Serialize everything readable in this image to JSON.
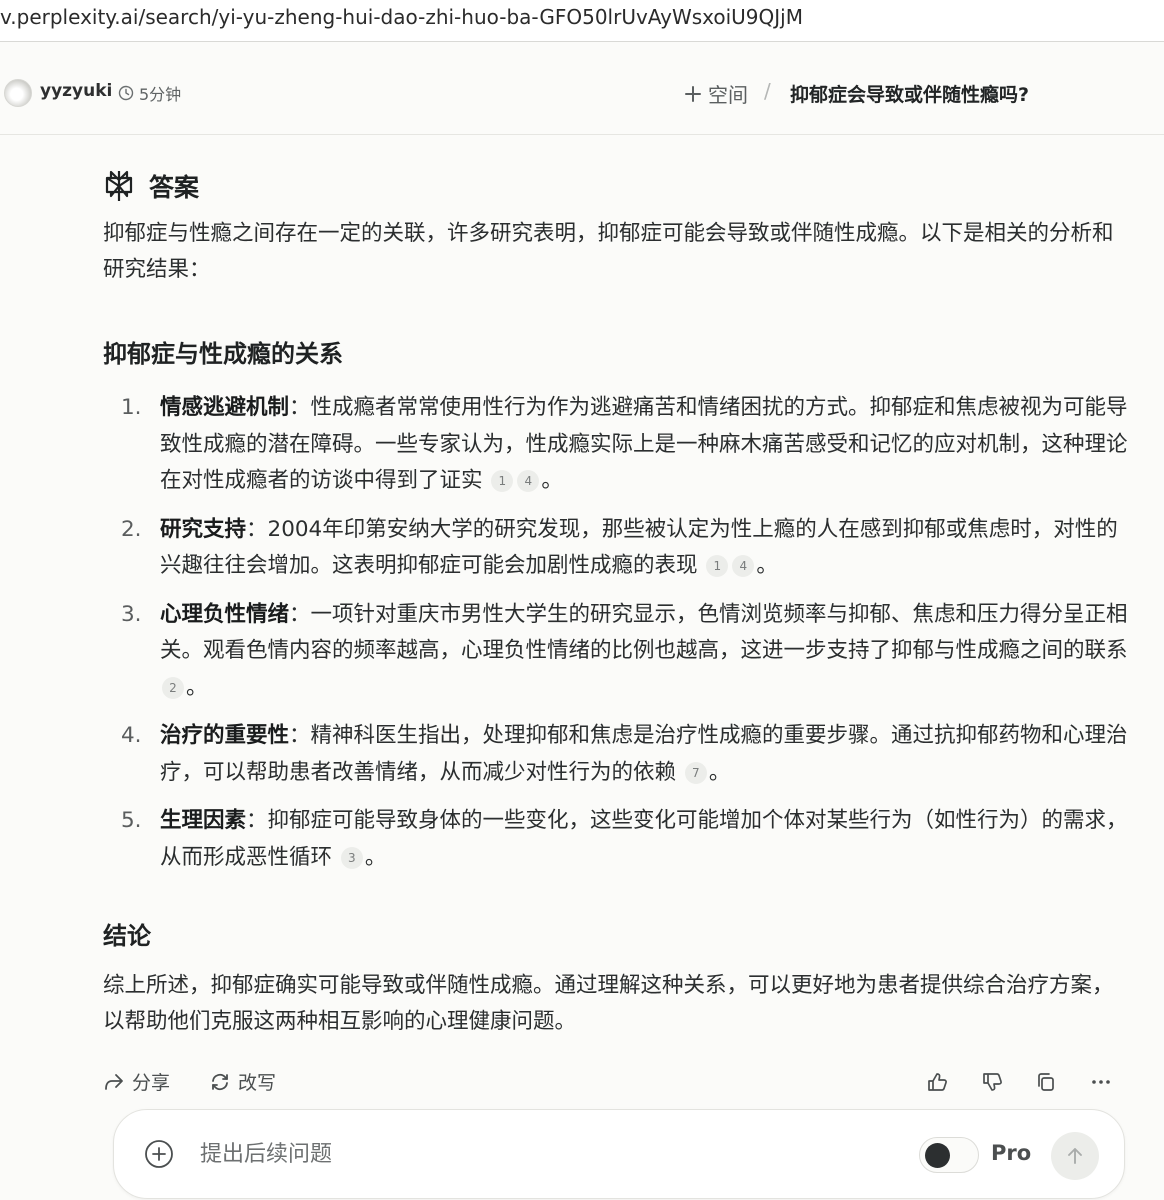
{
  "browser": {
    "url": "v.perplexity.ai/search/yi-yu-zheng-hui-dao-zhi-huo-ba-GFO50lrUvAyWsxoiU9QJjM"
  },
  "header": {
    "username": "yyzyuki",
    "time": "5分钟",
    "space_label": "空间",
    "separator": "/",
    "thread_title": "抑郁症会导致或伴随性瘾吗?"
  },
  "answer": {
    "heading": "答案",
    "intro": "抑郁症与性瘾之间存在一定的关联，许多研究表明，抑郁症可能会导致或伴随性成瘾。以下是相关的分析和研究结果：",
    "section1_title": "抑郁症与性成瘾的关系",
    "items": [
      {
        "num": "1.",
        "title": "情感逃避机制",
        "text": "：性成瘾者常常使用性行为作为逃避痛苦和情绪困扰的方式。抑郁症和焦虑被视为可能导致性成瘾的潜在障碍。一些专家认为，性成瘾实际上是一种麻木痛苦感受和记忆的应对机制，这种理论在对性成瘾者的访谈中得到了证实",
        "cites": [
          "1",
          "4"
        ],
        "end": "。"
      },
      {
        "num": "2.",
        "title": "研究支持",
        "text": "：2004年印第安纳大学的研究发现，那些被认定为性上瘾的人在感到抑郁或焦虑时，对性的兴趣往往会增加。这表明抑郁症可能会加剧性成瘾的表现",
        "cites": [
          "1",
          "4"
        ],
        "end": "。"
      },
      {
        "num": "3.",
        "title": "心理负性情绪",
        "text": "：一项针对重庆市男性大学生的研究显示，色情浏览频率与抑郁、焦虑和压力得分呈正相关。观看色情内容的频率越高，心理负性情绪的比例也越高，这进一步支持了抑郁与性成瘾之间的联系",
        "cites": [
          "2"
        ],
        "end": "。"
      },
      {
        "num": "4.",
        "title": "治疗的重要性",
        "text": "：精神科医生指出，处理抑郁和焦虑是治疗性成瘾的重要步骤。通过抗抑郁药物和心理治疗，可以帮助患者改善情绪，从而减少对性行为的依赖",
        "cites": [
          "7"
        ],
        "end": "。"
      },
      {
        "num": "5.",
        "title": "生理因素",
        "text": "：抑郁症可能导致身体的一些变化，这些变化可能增加个体对某些行为（如性行为）的需求，从而形成恶性循环",
        "cites": [
          "3"
        ],
        "end": "。"
      }
    ],
    "section2_title": "结论",
    "conclusion": "综上所述，抑郁症确实可能导致或伴随性成瘾。通过理解这种关系，可以更好地为患者提供综合治疗方案，以帮助他们克服这两种相互影响的心理健康问题。"
  },
  "actions": {
    "share_label": "分享",
    "rewrite_label": "改写"
  },
  "composer": {
    "placeholder": "提出后续问题",
    "pro_label": "Pro",
    "pro_enabled": false
  },
  "icons": {
    "clock": "clock-icon",
    "plus": "plus-icon",
    "logo": "perplexity-logo-icon",
    "share": "share-icon",
    "rewrite": "rewrite-icon",
    "like": "thumbs-up-icon",
    "dislike": "thumbs-down-icon",
    "copy": "copy-icon",
    "more": "more-icon",
    "attach": "attach-plus-icon",
    "send": "arrow-up-icon"
  }
}
